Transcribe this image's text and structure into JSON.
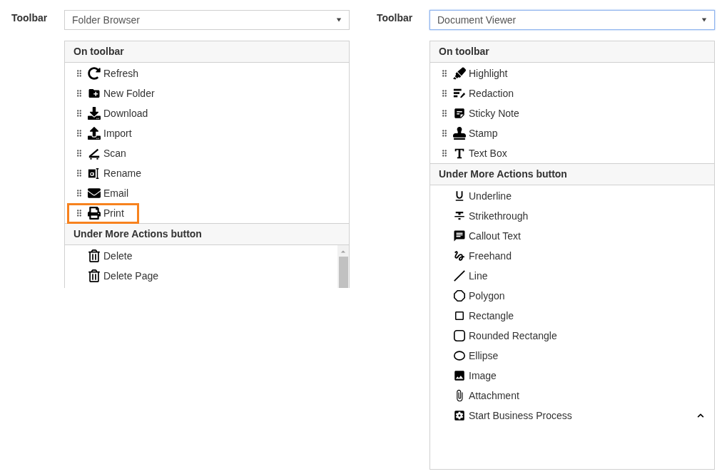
{
  "panels": [
    {
      "label": "Toolbar",
      "select": {
        "value": "Folder Browser",
        "focused": false
      },
      "sections": [
        {
          "title": "On toolbar",
          "scrollable": false,
          "items": [
            {
              "text": "Refresh",
              "kind": "refresh",
              "draggable": true,
              "highlighted": false,
              "chevron": false
            },
            {
              "text": "New Folder",
              "kind": "newfolder",
              "draggable": true,
              "highlighted": false,
              "chevron": false
            },
            {
              "text": "Download",
              "kind": "download",
              "draggable": true,
              "highlighted": false,
              "chevron": false
            },
            {
              "text": "Import",
              "kind": "upload",
              "draggable": true,
              "highlighted": false,
              "chevron": false
            },
            {
              "text": "Scan",
              "kind": "scan",
              "draggable": true,
              "highlighted": false,
              "chevron": false
            },
            {
              "text": "Rename",
              "kind": "rename",
              "draggable": true,
              "highlighted": false,
              "chevron": false
            },
            {
              "text": "Email",
              "kind": "email",
              "draggable": true,
              "highlighted": false,
              "chevron": false
            },
            {
              "text": "Print",
              "kind": "print",
              "draggable": true,
              "highlighted": true,
              "chevron": false
            }
          ]
        },
        {
          "title": "Under More Actions button",
          "scrollable": true,
          "items": [
            {
              "text": "Delete",
              "kind": "trash",
              "draggable": false,
              "highlighted": false,
              "chevron": false
            },
            {
              "text": "Delete Page",
              "kind": "trash",
              "draggable": false,
              "highlighted": false,
              "chevron": false
            }
          ]
        }
      ]
    },
    {
      "label": "Toolbar",
      "select": {
        "value": "Document Viewer",
        "focused": true
      },
      "sections": [
        {
          "title": "On toolbar",
          "scrollable": false,
          "items": [
            {
              "text": "Highlight",
              "kind": "highlighter",
              "draggable": true,
              "highlighted": false,
              "chevron": false
            },
            {
              "text": "Redaction",
              "kind": "redaction",
              "draggable": true,
              "highlighted": false,
              "chevron": false
            },
            {
              "text": "Sticky Note",
              "kind": "note",
              "draggable": true,
              "highlighted": false,
              "chevron": false
            },
            {
              "text": "Stamp",
              "kind": "stamp",
              "draggable": true,
              "highlighted": false,
              "chevron": false
            },
            {
              "text": "Text Box",
              "kind": "text",
              "draggable": true,
              "highlighted": false,
              "chevron": false
            }
          ]
        },
        {
          "title": "Under More Actions button",
          "scrollable": false,
          "items": [
            {
              "text": "Underline",
              "kind": "underline",
              "draggable": false,
              "highlighted": false,
              "chevron": false
            },
            {
              "text": "Strikethrough",
              "kind": "strike",
              "draggable": false,
              "highlighted": false,
              "chevron": false
            },
            {
              "text": "Callout Text",
              "kind": "callout",
              "draggable": false,
              "highlighted": false,
              "chevron": false
            },
            {
              "text": "Freehand",
              "kind": "freehand",
              "draggable": false,
              "highlighted": false,
              "chevron": false
            },
            {
              "text": "Line",
              "kind": "line",
              "draggable": false,
              "highlighted": false,
              "chevron": false
            },
            {
              "text": "Polygon",
              "kind": "polygon",
              "draggable": false,
              "highlighted": false,
              "chevron": false
            },
            {
              "text": "Rectangle",
              "kind": "rect",
              "draggable": false,
              "highlighted": false,
              "chevron": false
            },
            {
              "text": "Rounded Rectangle",
              "kind": "roundrect",
              "draggable": false,
              "highlighted": false,
              "chevron": false
            },
            {
              "text": "Ellipse",
              "kind": "ellipse",
              "draggable": false,
              "highlighted": false,
              "chevron": false
            },
            {
              "text": "Image",
              "kind": "image",
              "draggable": false,
              "highlighted": false,
              "chevron": false
            },
            {
              "text": "Attachment",
              "kind": "attach",
              "draggable": false,
              "highlighted": false,
              "chevron": false
            },
            {
              "text": "Start Business Process",
              "kind": "gear",
              "draggable": false,
              "highlighted": false,
              "chevron": true
            }
          ]
        }
      ]
    }
  ]
}
